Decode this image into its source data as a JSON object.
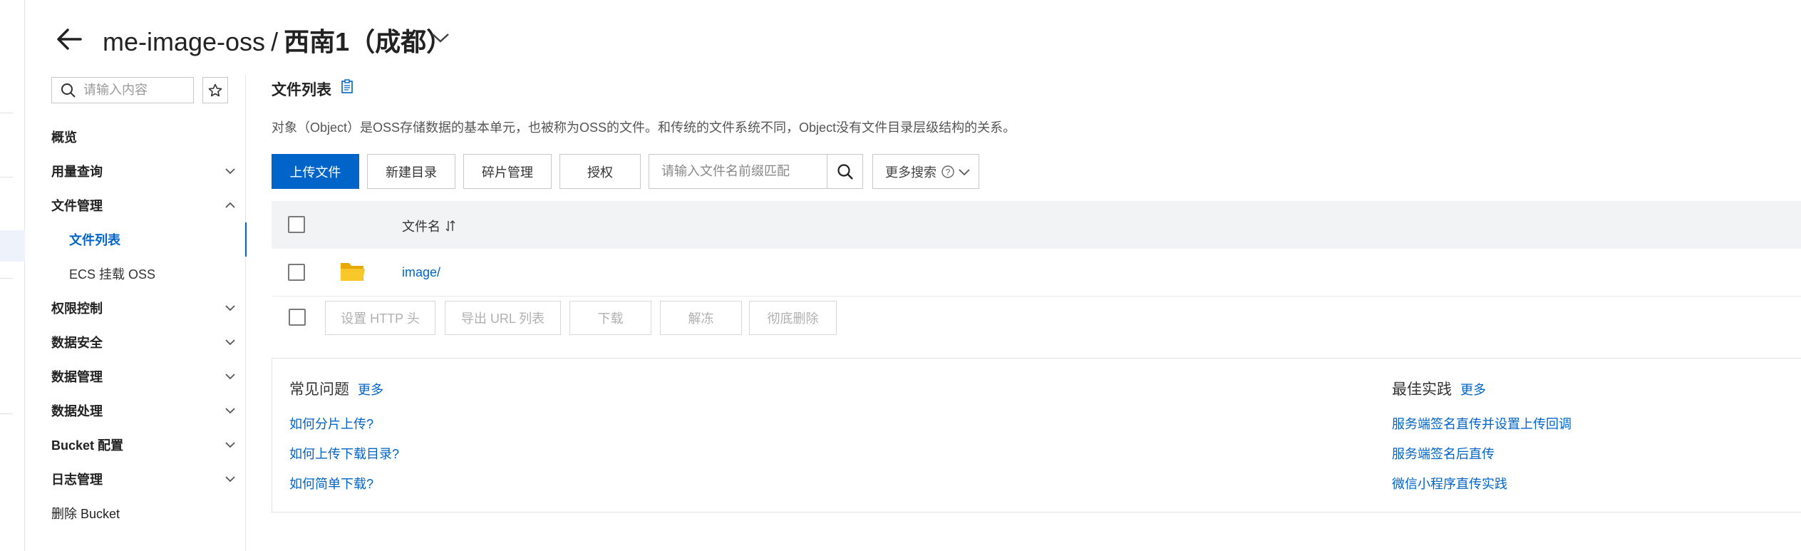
{
  "header": {
    "bucket_name": "me-image-oss",
    "separator": "/",
    "region": "西南1（成都）"
  },
  "sidebar": {
    "search_placeholder": "请输入内容",
    "items": [
      {
        "label": "概览"
      },
      {
        "label": "用量查询"
      },
      {
        "label": "文件管理"
      },
      {
        "label": "文件列表"
      },
      {
        "label": "ECS 挂载 OSS"
      },
      {
        "label": "权限控制"
      },
      {
        "label": "数据安全"
      },
      {
        "label": "数据管理"
      },
      {
        "label": "数据处理"
      },
      {
        "label": "Bucket 配置"
      },
      {
        "label": "日志管理"
      },
      {
        "label": "删除 Bucket"
      }
    ]
  },
  "main": {
    "section_title": "文件列表",
    "description": "对象（Object）是OSS存储数据的基本单元，也被称为OSS的文件。和传统的文件系统不同，Object没有文件目录层级结构的关系。",
    "toolbar": {
      "upload": "上传文件",
      "new_dir": "新建目录",
      "fragments": "碎片管理",
      "authorize": "授权",
      "search_placeholder": "请输入文件名前缀匹配",
      "more_search": "更多搜索"
    },
    "table": {
      "col_name": "文件名",
      "rows": [
        {
          "name": "image/"
        }
      ]
    },
    "batch": {
      "set_http": "设置 HTTP 头",
      "export_url": "导出 URL 列表",
      "download": "下载",
      "unfreeze": "解冻",
      "delete": "彻底删除"
    },
    "faq": {
      "title": "常见问题",
      "more": "更多",
      "links": [
        "如何分片上传?",
        "如何上传下载目录?",
        "如何简单下载?"
      ]
    },
    "best": {
      "title": "最佳实践",
      "more": "更多",
      "links": [
        "服务端签名直传并设置上传回调",
        "服务端签名后直传",
        "微信小程序直传实践"
      ]
    }
  },
  "colors": {
    "primary": "#0064c8",
    "folder": "#f5c518",
    "table_header_bg": "#f2f3f5"
  }
}
